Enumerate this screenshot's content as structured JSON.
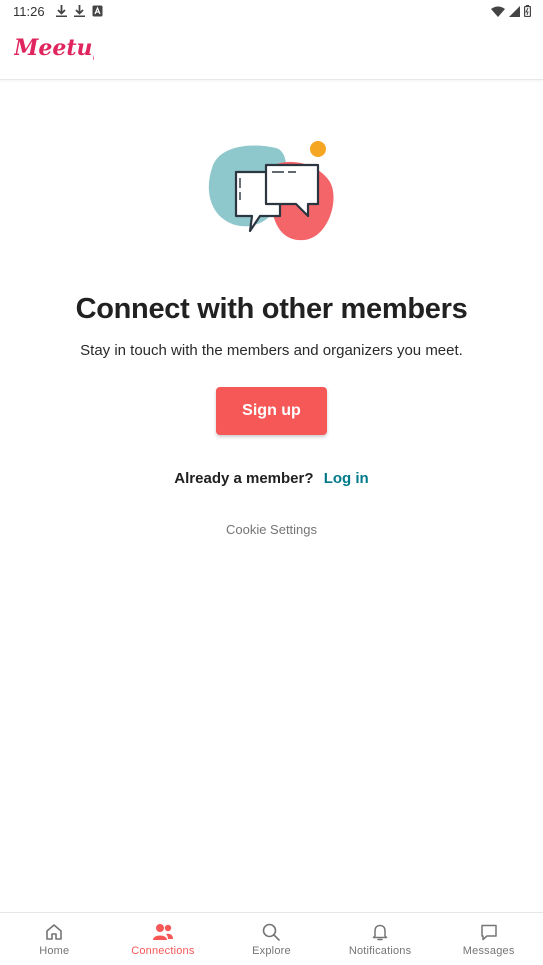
{
  "status_bar": {
    "time": "11:26"
  },
  "header": {
    "logo_text": "Meetup"
  },
  "main": {
    "headline": "Connect with other members",
    "subtext": "Stay in touch with the members and organizers you meet.",
    "signup_label": "Sign up",
    "member_question": "Already a member?",
    "login_label": "Log in",
    "cookie_label": "Cookie Settings"
  },
  "bottom_nav": {
    "items": [
      {
        "label": "Home",
        "icon": "home-icon",
        "active": false
      },
      {
        "label": "Connections",
        "icon": "connections-icon",
        "active": true
      },
      {
        "label": "Explore",
        "icon": "search-icon",
        "active": false
      },
      {
        "label": "Notifications",
        "icon": "bell-icon",
        "active": false
      },
      {
        "label": "Messages",
        "icon": "message-icon",
        "active": false
      }
    ]
  },
  "colors": {
    "brand": "#f65858",
    "link": "#00798a",
    "logo": "#e0245e",
    "blob_teal": "#8fc8cc",
    "blob_red": "#f4656a",
    "dot_orange": "#f5a623"
  }
}
